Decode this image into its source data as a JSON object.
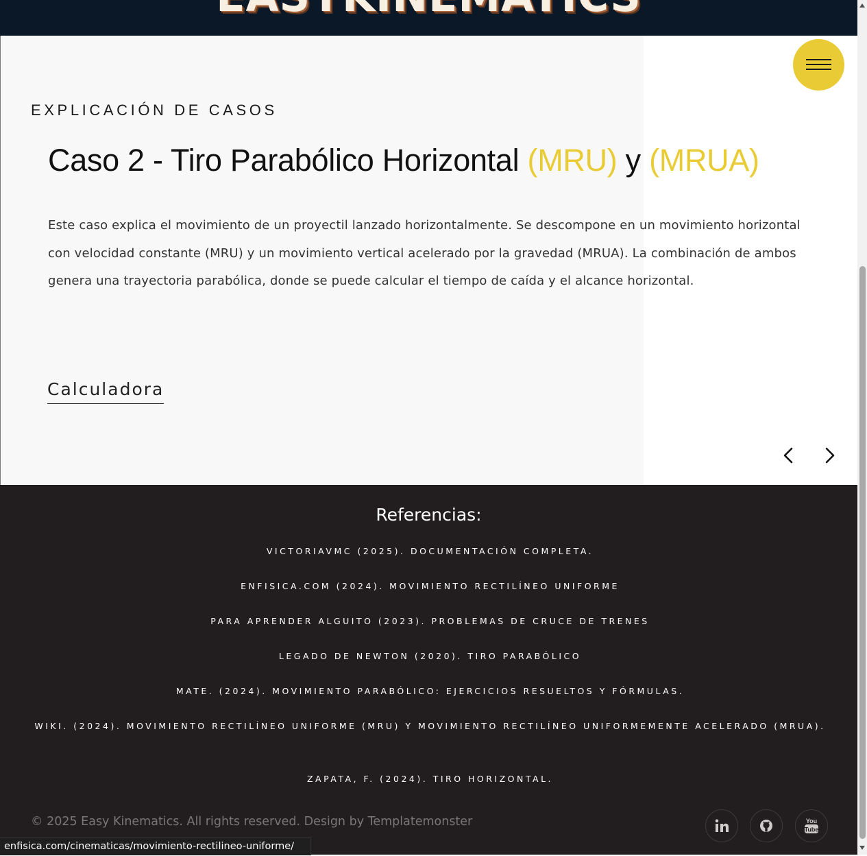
{
  "site": {
    "logo_text": "EASYKINEMATICS"
  },
  "slider": {
    "eyebrow": "EXPLICACIÓN DE CASOS",
    "title_prefix": "Caso 2 - Tiro Parabólico Horizontal ",
    "title_accent_1": "(MRU)",
    "title_connector": " y ",
    "title_accent_2": "(MRUA)",
    "description": "Este caso explica el movimiento de un proyectil lanzado horizontalmente. Se descompone en un movimiento horizontal con velocidad constante (MRU) y un movimiento vertical acelerado por la gravedad (MRUA). La combinación de ambos genera una trayectoria parabólica, donde se puede calcular el tiempo de caída y el alcance horizontal.",
    "link_label": "Calculadora",
    "prev_icon": "chevron-left-icon",
    "next_icon": "chevron-right-icon"
  },
  "menu": {
    "icon": "hamburger-menu-icon"
  },
  "footer": {
    "heading": "Referencias:",
    "references": [
      "VictoriaVMC (2025). Documentación completa.",
      "Enfisica.com (2024). Movimiento Rectilíneo Uniforme",
      "Para Aprender Alguito (2023). Problemas de cruce de trenes",
      "Legado de Newton (2020). Tiro parabólico",
      "Mate. (2024). Movimiento Parabólico: Ejercicios Resueltos y Fórmulas.",
      "Wiki. (2024). Movimiento Rectilíneo Uniforme (MRU) y Movimiento Rectilíneo Uniformemente Acelerado (MRUA).",
      "Zapata, F. (2024). Tiro horizontal."
    ],
    "copyright": "©  2025 Easy Kinematics. All rights reserved. Design by Templatemonster",
    "social_icons": [
      "linkedin-icon",
      "github-icon",
      "youtube-icon"
    ]
  },
  "browser": {
    "status_url": "enfisica.com/cinematicas/movimiento-rectilineo-uniforme/"
  },
  "colors": {
    "accent": "#e9cb36",
    "footer_bg": "#221e1f",
    "header_bg": "#0b1828",
    "panel_bg": "#f8f8f8"
  }
}
